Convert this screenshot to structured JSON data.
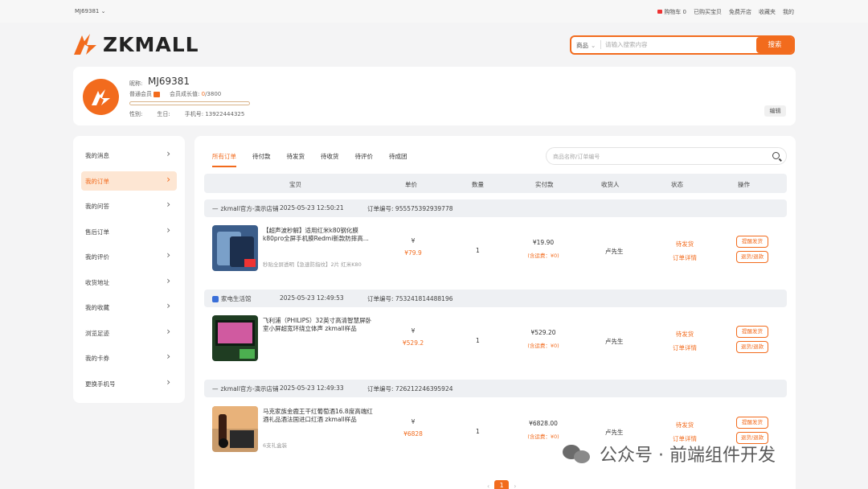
{
  "topbar": {
    "user": "MJ69381",
    "links": [
      "购物车 0",
      "已购买宝贝",
      "免费开店",
      "收藏夹",
      "我的"
    ]
  },
  "header": {
    "logo_text": "ZKMALL",
    "search": {
      "category": "商品",
      "placeholder": "请输入搜索内容",
      "button": "搜索"
    }
  },
  "profile": {
    "nick_label": "昵称:",
    "nick": "MJ69381",
    "level": "普通会员",
    "growth_label": "会员成长值:",
    "growth_current": "0",
    "growth_total": "/3800",
    "growth_fraction": 0.0,
    "gender_label": "性别:",
    "birthday_label": "生日:",
    "phone_label": "手机号:",
    "phone": "13922444325",
    "edit": "编辑"
  },
  "sidebar": {
    "items": [
      {
        "label": "我的消息",
        "active": false
      },
      {
        "label": "我的订单",
        "active": true
      },
      {
        "label": "我的问答",
        "active": false
      },
      {
        "label": "售后订单",
        "active": false
      },
      {
        "label": "我的评价",
        "active": false
      },
      {
        "label": "收货地址",
        "active": false
      },
      {
        "label": "我的收藏",
        "active": false
      },
      {
        "label": "浏览足迹",
        "active": false
      },
      {
        "label": "我的卡券",
        "active": false
      },
      {
        "label": "更换手机号",
        "active": false
      }
    ]
  },
  "orders": {
    "tabs": [
      "所有订单",
      "待付款",
      "待发货",
      "待收货",
      "待评价",
      "待成团"
    ],
    "search_placeholder": "商品名称/订单编号",
    "columns": [
      "宝贝",
      "单价",
      "数量",
      "实付款",
      "收货人",
      "状态",
      "操作"
    ],
    "order_no_label": "订单编号:",
    "list": [
      {
        "shop": "zkmall官方-演示店铺",
        "time": "2025-05-23 12:50:21",
        "order_no": "955575392939778",
        "title": "【超声波秒解】适用红米k80钢化膜k80pro全屏手机膜Redmi新款防摔高...",
        "spec": "秒贴全屏透明【急速防指纹】2片   红米K80",
        "currency": "¥",
        "unit_price": "¥79.9",
        "qty": "1",
        "paid": "¥19.90",
        "ship": "(含运费：¥0)",
        "receiver": "卢先生",
        "status": "待发货",
        "detail": "订单详情",
        "op1": "提醒发货",
        "op2": "退货/退款"
      },
      {
        "shop": "家电生活馆",
        "time": "2025-05-23 12:49:53",
        "order_no": "753241814488196",
        "title": "飞利浦（PHILIPS）32英寸高清智慧屏卧室小屏超宽环绕立体声 zkmall样品",
        "spec": "",
        "currency": "¥",
        "unit_price": "¥529.2",
        "qty": "1",
        "paid": "¥529.20",
        "ship": "(含运费：¥0)",
        "receiver": "卢先生",
        "status": "待发货",
        "detail": "订单详情",
        "op1": "提醒发货",
        "op2": "退货/退款"
      },
      {
        "shop": "zkmall官方-演示店铺",
        "time": "2025-05-23 12:49:33",
        "order_no": "726212246395924",
        "title": "马克家族金鹿王干红葡萄酒16.8度高端红酒礼品酒法国进口红酒 zkmall样品",
        "spec": "6支礼盒装",
        "currency": "¥",
        "unit_price": "¥6828",
        "qty": "1",
        "paid": "¥6828.00",
        "ship": "(含运费：¥0)",
        "receiver": "卢先生",
        "status": "待发货",
        "detail": "订单详情",
        "op1": "提醒发货",
        "op2": "退货/退款"
      }
    ],
    "page": "1"
  },
  "watermark": "公众号 · 前端组件开发",
  "colors": {
    "accent": "#f26b1d",
    "bg": "#f4f4f5",
    "table_head": "#eef0f3"
  }
}
